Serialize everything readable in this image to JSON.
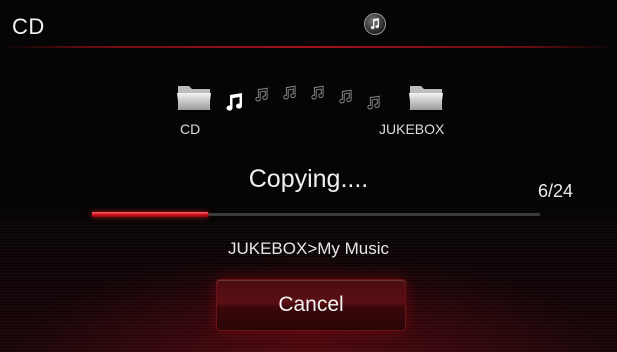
{
  "header": {
    "source": "CD",
    "mode_icon": "music-note-icon"
  },
  "transfer": {
    "from_label": "CD",
    "to_label": "JUKEBOX",
    "folder_icon": "folder-icon",
    "notes_icon": "music-note-icon"
  },
  "status": {
    "text": "Copying....",
    "counter": "6/24",
    "progress": 0.26,
    "destination": "JUKEBOX>My Music"
  },
  "actions": {
    "cancel_label": "Cancel"
  },
  "colors": {
    "accent": "#c0121e",
    "background": "#050505"
  }
}
